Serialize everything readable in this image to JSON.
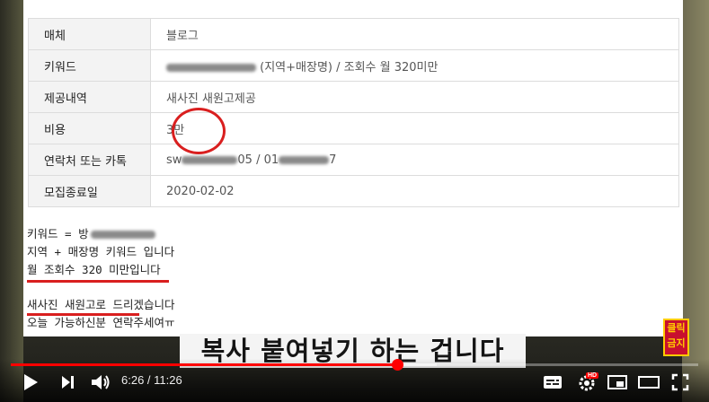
{
  "table": {
    "rows": [
      {
        "label": "매체",
        "value": "블로그"
      },
      {
        "label": "키워드",
        "value": "(지역+매장명) / 조회수 월 320미만"
      },
      {
        "label": "제공내역",
        "value": "새사진 새원고제공"
      },
      {
        "label": "비용",
        "value": "3만"
      },
      {
        "label": "연락처 또는 카톡",
        "value_a": "sw",
        "value_b": "05 / 01",
        "value_c": "7"
      },
      {
        "label": "모집종료일",
        "value": "2020-02-02"
      }
    ]
  },
  "post": {
    "line1": "키워드 = 방",
    "line2": "지역 + 매장명 키워드 입니다",
    "line3": "월 조회수 320 미만입니다",
    "line4": "새사진 새원고로 드리겠습니다",
    "line5": "오늘 가능하신분 연락주세여ㅠ"
  },
  "caption": "복사 붙여넣기 하는 겁니다",
  "channel_logo": {
    "line1": "클릭",
    "line2": "금지"
  },
  "player": {
    "current_time": "6:26",
    "separator": " / ",
    "duration": "11:26",
    "progress_fraction": 0.562,
    "buffered_fraction": 0.62,
    "hd_badge": "HD",
    "accent_color": "#ff0000"
  }
}
